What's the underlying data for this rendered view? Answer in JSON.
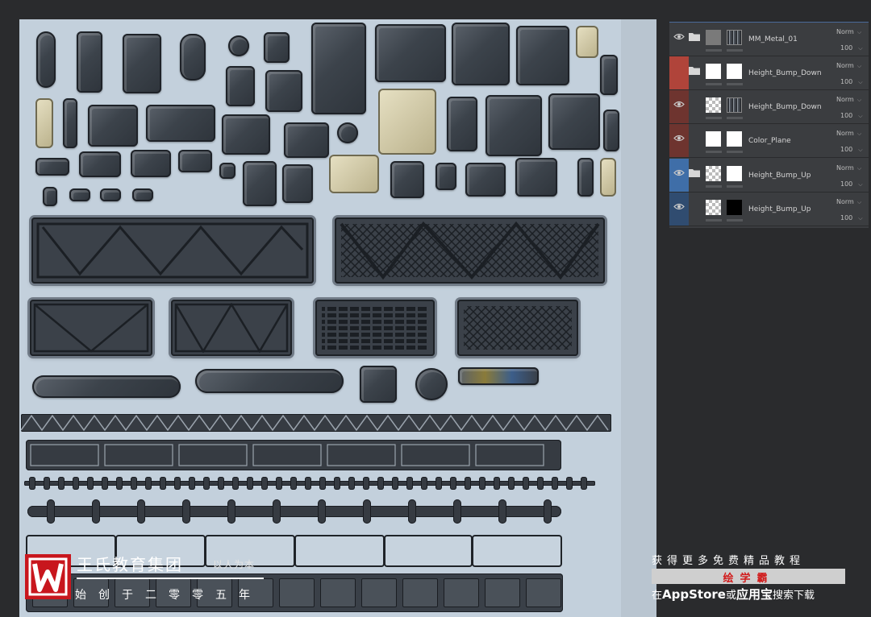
{
  "layers_panel": {
    "layers": [
      {
        "name": "MM_Metal_01",
        "blend": "Norm",
        "opacity": "100",
        "visible": true,
        "folder": true,
        "color": "#3b3d40",
        "thumb": "gray",
        "mask": "texture"
      },
      {
        "name": "Height_Bump_Down",
        "blend": "Norm",
        "opacity": "100",
        "visible": false,
        "folder": true,
        "color": "#b0443a",
        "thumb": "white",
        "mask": "white"
      },
      {
        "name": "Height_Bump_Down",
        "blend": "Norm",
        "opacity": "100",
        "visible": true,
        "folder": false,
        "color": "#6e342f",
        "thumb": "checker",
        "mask": "texture"
      },
      {
        "name": "Color_Plane",
        "blend": "Norm",
        "opacity": "100",
        "visible": true,
        "folder": false,
        "color": "#6e342f",
        "thumb": "white",
        "mask": "white"
      },
      {
        "name": "Height_Bump_Up",
        "blend": "Norm",
        "opacity": "100",
        "visible": true,
        "folder": true,
        "color": "#3f6ea8",
        "thumb": "checker",
        "mask": "white"
      },
      {
        "name": "Height_Bump_Up",
        "blend": "Norm",
        "opacity": "100",
        "visible": true,
        "folder": false,
        "color": "#304c70",
        "thumb": "checker",
        "mask": "black"
      }
    ]
  },
  "watermark": {
    "brand_title": "王氏教育集团",
    "brand_tagline": "以人为本",
    "brand_subtitle": "始创于二零零五年",
    "promo_top": "获得更多免费精品教程",
    "promo_app": "绘学霸",
    "promo_prefix": "在",
    "promo_store1": "AppStore",
    "promo_or": "或",
    "promo_store2": "应用宝",
    "promo_suffix": "搜索下载"
  },
  "colors": {
    "canvas_bg": "#c3d0dc",
    "app_bg": "#2a2b2d",
    "panel_bg": "#3b3d40",
    "logo_red": "#c8161d",
    "promo_red": "#d11a1a"
  }
}
